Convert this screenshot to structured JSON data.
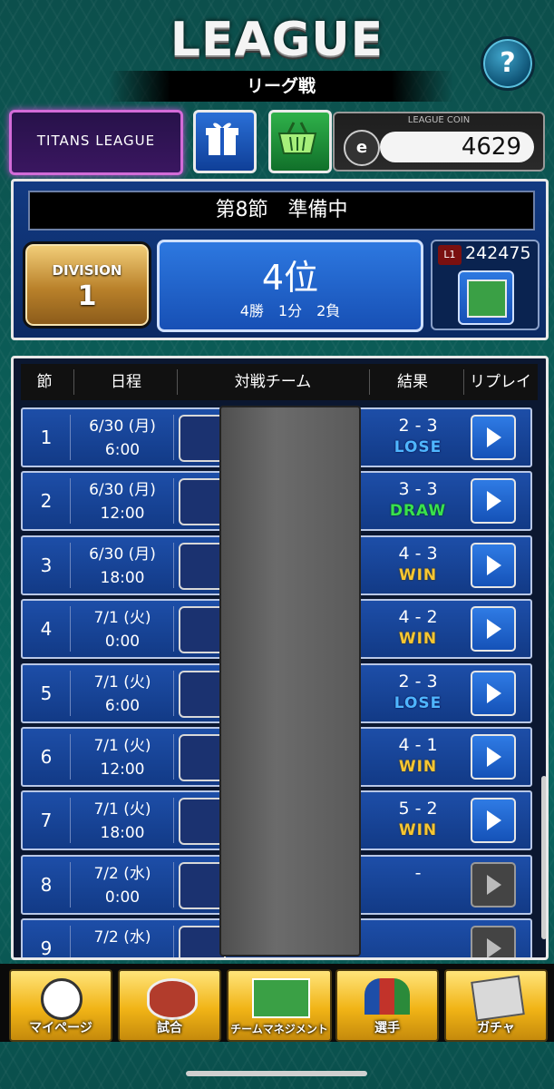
{
  "header": {
    "title": "LEAGUE",
    "subtitle": "リーグ戦",
    "help_label": "?"
  },
  "topbar": {
    "league_logo_text": "TITANS LEAGUE",
    "coin_label": "LEAGUE COIN",
    "coin_value": "4629",
    "gift_icon": "gift-icon",
    "shop_icon": "basket-icon"
  },
  "status": {
    "round": "第8節　準備中",
    "division_label": "DIVISION",
    "division_value": "1",
    "rank": "4位",
    "record": "4勝　1分　2負",
    "level_badge": "L1",
    "team_strength": "242475"
  },
  "schedule": {
    "headers": [
      "節",
      "日程",
      "対戦チーム",
      "結果",
      "リプレイ"
    ],
    "rows": [
      {
        "no": "1",
        "date": "6/30 (月)",
        "time": "6:00",
        "score": "2 - 3",
        "result": "LOSE",
        "replay": true
      },
      {
        "no": "2",
        "date": "6/30 (月)",
        "time": "12:00",
        "score": "3 - 3",
        "result": "DRAW",
        "replay": true
      },
      {
        "no": "3",
        "date": "6/30 (月)",
        "time": "18:00",
        "score": "4 - 3",
        "result": "WIN",
        "replay": true
      },
      {
        "no": "4",
        "date": "7/1 (火)",
        "time": "0:00",
        "score": "4 - 2",
        "result": "WIN",
        "replay": true
      },
      {
        "no": "5",
        "date": "7/1 (火)",
        "time": "6:00",
        "score": "2 - 3",
        "result": "LOSE",
        "replay": true
      },
      {
        "no": "6",
        "date": "7/1 (火)",
        "time": "12:00",
        "score": "4 - 1",
        "result": "WIN",
        "replay": true
      },
      {
        "no": "7",
        "date": "7/1 (火)",
        "time": "18:00",
        "score": "5 - 2",
        "result": "WIN",
        "replay": true
      },
      {
        "no": "8",
        "date": "7/2 (水)",
        "time": "0:00",
        "score": "-",
        "result": "",
        "replay": false
      },
      {
        "no": "9",
        "date": "7/2 (水)",
        "time": "",
        "score": "",
        "result": "",
        "replay": false
      }
    ]
  },
  "nav": {
    "items": [
      "マイページ",
      "試合",
      "チームマネジメント",
      "選手",
      "ガチャ"
    ]
  }
}
